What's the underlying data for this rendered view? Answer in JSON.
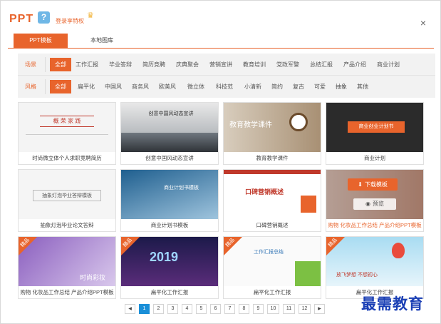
{
  "header": {
    "logo": "PPT",
    "avatar_char": "?",
    "login": "登录享特权",
    "crown_icon": "crown-icon",
    "close_icon": "close-icon"
  },
  "tabs": [
    {
      "label": "PPT模板",
      "active": true
    },
    {
      "label": "本地图库",
      "active": false
    }
  ],
  "filters": {
    "scene": {
      "label": "场景",
      "items": [
        "全部",
        "工作汇报",
        "毕业答辩",
        "简历竞聘",
        "庆典聚会",
        "营销宣讲",
        "教育培训",
        "党政军警",
        "总结汇报",
        "产品介绍",
        "商业计划"
      ]
    },
    "style": {
      "label": "风格",
      "items": [
        "全部",
        "扁平化",
        "中国风",
        "商务风",
        "欧美风",
        "微立体",
        "科技范",
        "小清新",
        "简约",
        "复古",
        "可爱",
        "抽象",
        "其他"
      ]
    }
  },
  "cards": [
    {
      "caption": "时尚微立体个人求职竞聘简历",
      "thumb_text": "概 荣 家 践"
    },
    {
      "caption": "创意中国风动态宣讲",
      "thumb_text": "创意中国风动态宣讲"
    },
    {
      "caption": "教育教学课件",
      "thumb_text": "教育教学课件"
    },
    {
      "caption": "商业计划",
      "thumb_text": "商业创业计划书"
    },
    {
      "caption": "抽象灯泡毕业论文答辩",
      "thumb_text": "抽象灯泡毕业答辩模板"
    },
    {
      "caption": "商业计划书模板",
      "thumb_text": "商业计划书模板"
    },
    {
      "caption": "口碑营销概述",
      "thumb_text": "口碑营销概述"
    },
    {
      "caption": "购物 化妆品工作总结 产品介绍PPT模板",
      "download": "下载模板",
      "preview": "预览"
    },
    {
      "caption": "购物 化妆品工作总结 产品介绍PPT模板",
      "thumb_text": "时尚彩妆",
      "badge": "精品"
    },
    {
      "caption": "扁平化工作汇报",
      "thumb_text": "2019",
      "badge": "精品"
    },
    {
      "caption": "扁平化工作汇报",
      "thumb_text": "工作汇报总结",
      "badge": "精品"
    },
    {
      "caption": "扁平化工作汇报",
      "thumb_text": "放飞梦想 不想初心",
      "badge": "精品"
    }
  ],
  "pagination": {
    "prev": "◀",
    "next": "▶",
    "pages": [
      "1",
      "2",
      "3",
      "4",
      "5",
      "6",
      "7",
      "8",
      "9",
      "10",
      "11",
      "12"
    ],
    "current": "1"
  },
  "watermark": "最需教育",
  "colors": {
    "accent": "#e8642c",
    "page_active": "#1a8fd8",
    "watermark": "#1a3fb5"
  }
}
